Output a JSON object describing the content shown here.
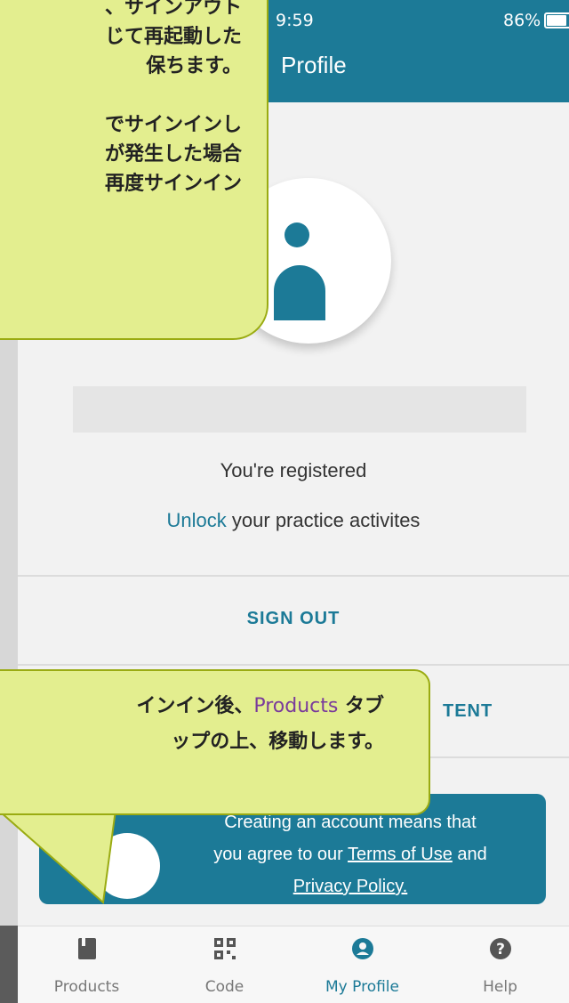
{
  "status_bar": {
    "time": "9:59",
    "battery": "86%"
  },
  "header": {
    "title": "Profile"
  },
  "profile": {
    "registered_text": "You're registered",
    "unlock_link": "Unlock",
    "unlock_rest": " your practice activites"
  },
  "actions": {
    "sign_out": "SIGN OUT",
    "content_partial": "TENT"
  },
  "terms": {
    "line1": "Creating an account means that",
    "line2_prefix": "you agree to our ",
    "terms_link": "Terms of Use",
    "line2_suffix": " and",
    "privacy_link": "Privacy Policy."
  },
  "tabs": [
    {
      "label": "Products",
      "icon": "book-icon"
    },
    {
      "label": "Code",
      "icon": "qr-code-icon"
    },
    {
      "label": "My Profile",
      "icon": "user-circle-icon"
    },
    {
      "label": "Help",
      "icon": "question-icon"
    }
  ],
  "callouts": {
    "top_text": "、サインアウト\nじて再起動した\n保ちます。\n\nでサインインし\nが発生した場合\n再度サインイン",
    "bottom_text_a": "インイン後、",
    "bottom_products": "Products",
    "bottom_text_b": " タブ",
    "bottom_line2": "ップの上、移動します。"
  },
  "colors": {
    "accent": "#1c7a97",
    "callout_bg": "#e3ee8f",
    "callout_border": "#9aab12"
  }
}
